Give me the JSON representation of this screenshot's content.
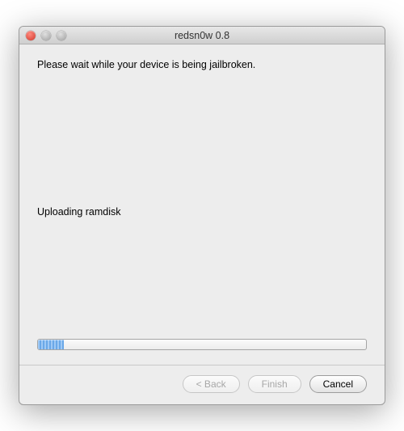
{
  "window": {
    "title": "redsn0w 0.8"
  },
  "content": {
    "instruction": "Please wait while your device is being jailbroken.",
    "status": "Uploading ramdisk",
    "progress_percent": 8
  },
  "buttons": {
    "back": "< Back",
    "finish": "Finish",
    "cancel": "Cancel"
  }
}
